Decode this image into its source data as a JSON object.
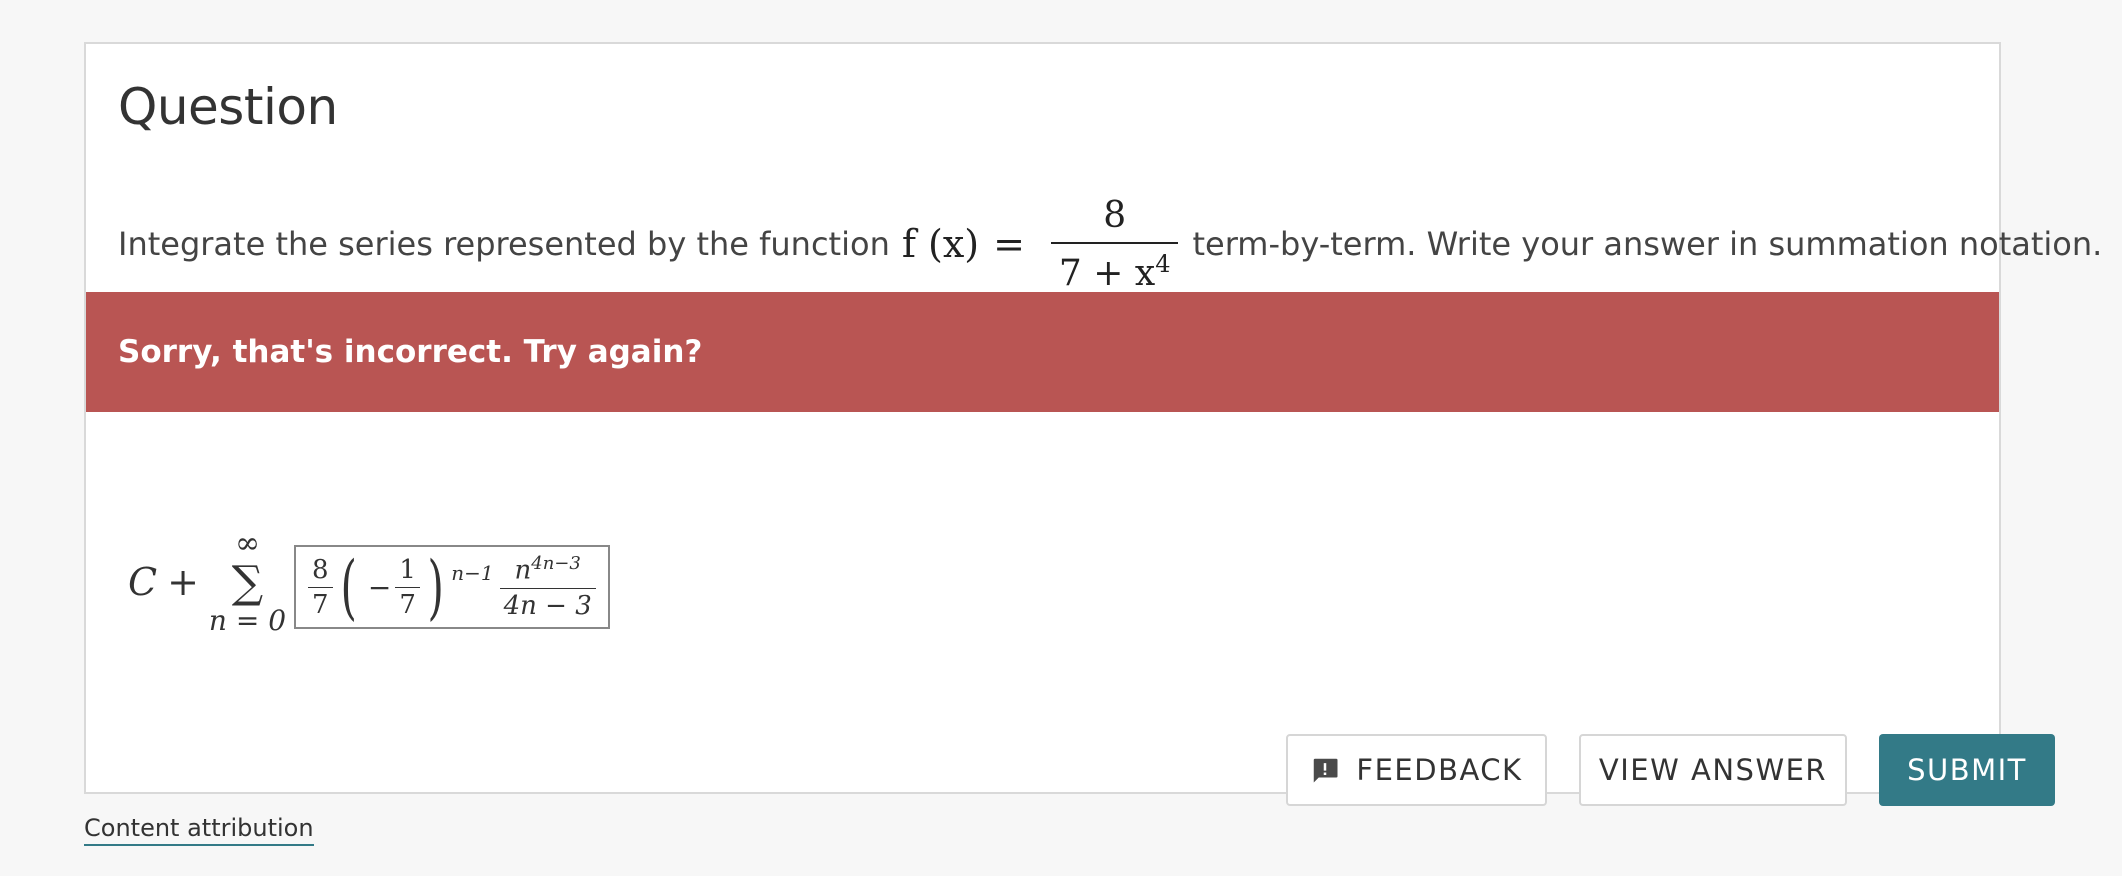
{
  "question": {
    "title": "Question",
    "text_before": "Integrate the series represented by the function",
    "function_name": "f (x)",
    "equals": "=",
    "fraction_numerator": "8",
    "fraction_denominator_base": "7 + x",
    "fraction_denominator_exponent": "4",
    "text_after": "term-by-term. Write your answer in summation notation."
  },
  "feedback": {
    "message": "Sorry, that's incorrect. Try again?",
    "color": "#b95553"
  },
  "answer": {
    "constant": "C",
    "plus": "+",
    "sum_upper": "∞",
    "sum_symbol": "∑",
    "sum_lower": "n = 0",
    "frac1_num": "8",
    "frac1_den": "7",
    "minus": "−",
    "frac2_num": "1",
    "frac2_den": "7",
    "paren_exponent": "n−1",
    "frac3_num": "n4n−3",
    "frac3_num_base": "n",
    "frac3_num_exp": "4n−3",
    "frac3_den": "4n − 3"
  },
  "buttons": {
    "feedback_label": "FEEDBACK",
    "view_answer_label": "VIEW ANSWER",
    "submit_label": "SUBMIT",
    "submit_color": "#337a87"
  },
  "footer": {
    "attribution_link": "Content attribution"
  }
}
